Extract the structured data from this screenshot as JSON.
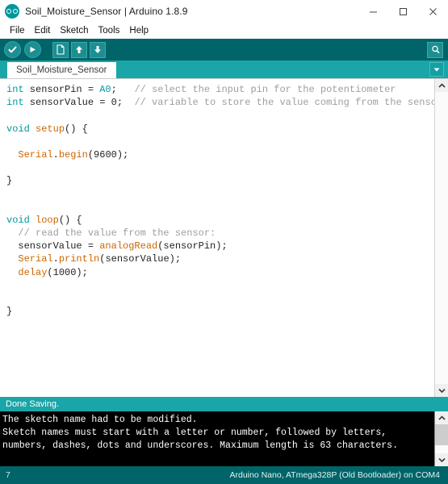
{
  "window": {
    "title": "Soil_Moisture_Sensor | Arduino 1.8.9",
    "logo_icon": "arduino-logo-icon",
    "controls": {
      "minimize": "minimize-icon",
      "maximize": "maximize-icon",
      "close": "close-icon"
    }
  },
  "menubar": {
    "items": [
      {
        "label": "File"
      },
      {
        "label": "Edit"
      },
      {
        "label": "Sketch"
      },
      {
        "label": "Tools"
      },
      {
        "label": "Help"
      }
    ]
  },
  "toolbar": {
    "verify_label": "Verify",
    "upload_label": "Upload",
    "new_label": "New",
    "open_label": "Open",
    "save_label": "Save",
    "serial_monitor_label": "Serial Monitor",
    "icons": {
      "verify": "check-icon",
      "upload": "arrow-right-icon",
      "new": "file-icon",
      "open": "arrow-up-icon",
      "save": "arrow-down-icon",
      "serial_monitor": "magnifier-icon"
    }
  },
  "tabs": {
    "items": [
      {
        "label": "Soil_Moisture_Sensor",
        "active": true
      }
    ],
    "menu_icon": "chevron-down-icon"
  },
  "editor": {
    "lines": [
      [
        {
          "t": "int",
          "c": "type"
        },
        {
          "t": " sensorPin = ",
          "c": "plain"
        },
        {
          "t": "A0",
          "c": "type"
        },
        {
          "t": ";   ",
          "c": "plain"
        },
        {
          "t": "// select the input pin for the potentiometer",
          "c": "cmt"
        }
      ],
      [
        {
          "t": "int",
          "c": "type"
        },
        {
          "t": " sensorValue = 0;  ",
          "c": "plain"
        },
        {
          "t": "// variable to store the value coming from the sensor",
          "c": "cmt"
        }
      ],
      [],
      [
        {
          "t": "void",
          "c": "type"
        },
        {
          "t": " ",
          "c": "plain"
        },
        {
          "t": "setup",
          "c": "fn"
        },
        {
          "t": "() {",
          "c": "plain"
        }
      ],
      [],
      [
        {
          "t": "  ",
          "c": "plain"
        },
        {
          "t": "Serial",
          "c": "cls"
        },
        {
          "t": ".",
          "c": "plain"
        },
        {
          "t": "begin",
          "c": "fn"
        },
        {
          "t": "(9600);",
          "c": "plain"
        }
      ],
      [],
      [
        {
          "t": "}",
          "c": "plain"
        }
      ],
      [],
      [],
      [
        {
          "t": "void",
          "c": "type"
        },
        {
          "t": " ",
          "c": "plain"
        },
        {
          "t": "loop",
          "c": "fn"
        },
        {
          "t": "() {",
          "c": "plain"
        }
      ],
      [
        {
          "t": "  ",
          "c": "plain"
        },
        {
          "t": "// read the value from the sensor:",
          "c": "cmt"
        }
      ],
      [
        {
          "t": "  sensorValue = ",
          "c": "plain"
        },
        {
          "t": "analogRead",
          "c": "fn"
        },
        {
          "t": "(sensorPin);",
          "c": "plain"
        }
      ],
      [
        {
          "t": "  ",
          "c": "plain"
        },
        {
          "t": "Serial",
          "c": "cls"
        },
        {
          "t": ".",
          "c": "plain"
        },
        {
          "t": "println",
          "c": "fn"
        },
        {
          "t": "(sensorValue);",
          "c": "plain"
        }
      ],
      [
        {
          "t": "  ",
          "c": "plain"
        },
        {
          "t": "delay",
          "c": "fn"
        },
        {
          "t": "(1000);",
          "c": "plain"
        }
      ],
      [],
      [],
      [
        {
          "t": "}",
          "c": "plain"
        }
      ]
    ]
  },
  "status_message": {
    "text": "Done Saving."
  },
  "console": {
    "lines": [
      "The sketch name had to be modified.",
      "Sketch names must start with a letter or number, followed by letters,",
      "numbers, dashes, dots and underscores. Maximum length is 63 characters."
    ]
  },
  "statusbar": {
    "line_number": "7",
    "board_info": "Arduino Nano, ATmega328P (Old Bootloader) on COM4"
  },
  "colors": {
    "toolbar_dark_teal": "#006468",
    "tab_teal": "#1aa5a8",
    "console_black": "#000000",
    "keyword_orange": "#cc6600",
    "type_teal": "#00979c",
    "comment_gray": "#9e9e9e"
  }
}
